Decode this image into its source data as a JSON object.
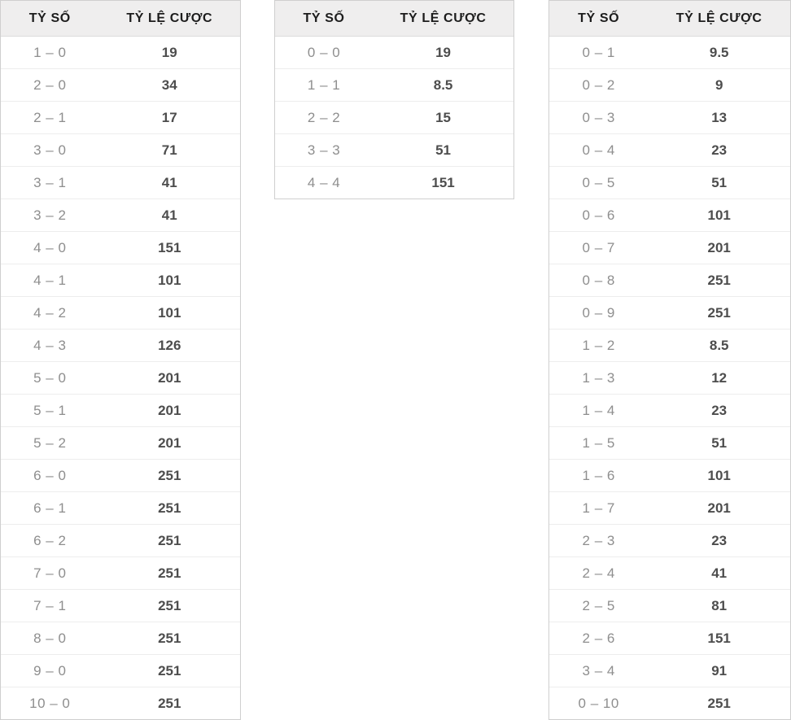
{
  "columns": {
    "score_header": "TỶ SỐ",
    "odds_header": "TỶ LỆ CƯỢC"
  },
  "colors": {
    "header_background": "#efeeee",
    "header_text": "#1c1c1c",
    "score_text": "#8e8e8e",
    "odds_text": "#4d4d4d",
    "table_border": "#cfcfcf",
    "row_divider": "#ededed",
    "page_background": "#ffffff"
  },
  "tables": [
    {
      "id": "home-win",
      "header": {
        "score": "TỶ SỐ",
        "odds": "TỶ LỆ CƯỢC"
      },
      "rows": [
        {
          "score": "1 – 0",
          "odds": "19"
        },
        {
          "score": "2 – 0",
          "odds": "34"
        },
        {
          "score": "2 – 1",
          "odds": "17"
        },
        {
          "score": "3 – 0",
          "odds": "71"
        },
        {
          "score": "3 – 1",
          "odds": "41"
        },
        {
          "score": "3 – 2",
          "odds": "41"
        },
        {
          "score": "4 – 0",
          "odds": "151"
        },
        {
          "score": "4 – 1",
          "odds": "101"
        },
        {
          "score": "4 – 2",
          "odds": "101"
        },
        {
          "score": "4 – 3",
          "odds": "126"
        },
        {
          "score": "5 – 0",
          "odds": "201"
        },
        {
          "score": "5 – 1",
          "odds": "201"
        },
        {
          "score": "5 – 2",
          "odds": "201"
        },
        {
          "score": "6 – 0",
          "odds": "251"
        },
        {
          "score": "6 – 1",
          "odds": "251"
        },
        {
          "score": "6 – 2",
          "odds": "251"
        },
        {
          "score": "7 – 0",
          "odds": "251"
        },
        {
          "score": "7 – 1",
          "odds": "251"
        },
        {
          "score": "8 – 0",
          "odds": "251"
        },
        {
          "score": "9 – 0",
          "odds": "251"
        },
        {
          "score": "10 – 0",
          "odds": "251"
        }
      ]
    },
    {
      "id": "draw",
      "header": {
        "score": "TỶ SỐ",
        "odds": "TỶ LỆ CƯỢC"
      },
      "rows": [
        {
          "score": "0 – 0",
          "odds": "19"
        },
        {
          "score": "1 – 1",
          "odds": "8.5"
        },
        {
          "score": "2 – 2",
          "odds": "15"
        },
        {
          "score": "3 – 3",
          "odds": "51"
        },
        {
          "score": "4 – 4",
          "odds": "151"
        }
      ]
    },
    {
      "id": "away-win",
      "header": {
        "score": "TỶ SỐ",
        "odds": "TỶ LỆ CƯỢC"
      },
      "rows": [
        {
          "score": "0 – 1",
          "odds": "9.5"
        },
        {
          "score": "0 – 2",
          "odds": "9"
        },
        {
          "score": "0 – 3",
          "odds": "13"
        },
        {
          "score": "0 – 4",
          "odds": "23"
        },
        {
          "score": "0 – 5",
          "odds": "51"
        },
        {
          "score": "0 – 6",
          "odds": "101"
        },
        {
          "score": "0 – 7",
          "odds": "201"
        },
        {
          "score": "0 – 8",
          "odds": "251"
        },
        {
          "score": "0 – 9",
          "odds": "251"
        },
        {
          "score": "1 – 2",
          "odds": "8.5"
        },
        {
          "score": "1 – 3",
          "odds": "12"
        },
        {
          "score": "1 – 4",
          "odds": "23"
        },
        {
          "score": "1 – 5",
          "odds": "51"
        },
        {
          "score": "1 – 6",
          "odds": "101"
        },
        {
          "score": "1 – 7",
          "odds": "201"
        },
        {
          "score": "2 – 3",
          "odds": "23"
        },
        {
          "score": "2 – 4",
          "odds": "41"
        },
        {
          "score": "2 – 5",
          "odds": "81"
        },
        {
          "score": "2 – 6",
          "odds": "151"
        },
        {
          "score": "3 – 4",
          "odds": "91"
        },
        {
          "score": "0 – 10",
          "odds": "251"
        }
      ]
    }
  ]
}
